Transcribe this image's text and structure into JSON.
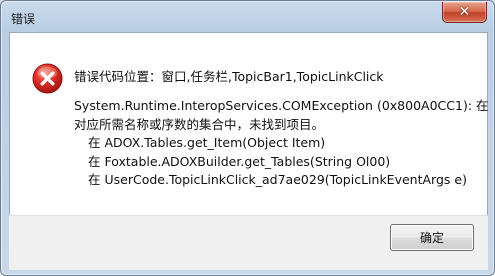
{
  "window": {
    "title": "错误",
    "close_glyph": "✕"
  },
  "message": {
    "icon": "error-icon",
    "title": "错误代码位置：窗口,任务栏,TopicBar1,TopicLinkClick",
    "lines": [
      "System.Runtime.InteropServices.COMException (0x800A0CC1): 在",
      "对应所需名称或序数的集合中，未找到项目。",
      "在 ADOX.Tables.get_Item(Object Item)",
      "在 Foxtable.ADOXBuilder.get_Tables(String Ol00)",
      "在 UserCode.TopicLinkClick_ad7ae029(TopicLinkEventArgs e)"
    ]
  },
  "buttons": {
    "ok_label": "确定"
  },
  "colors": {
    "error_red": "#d8281f",
    "frame_blue": "#b9cde3"
  }
}
